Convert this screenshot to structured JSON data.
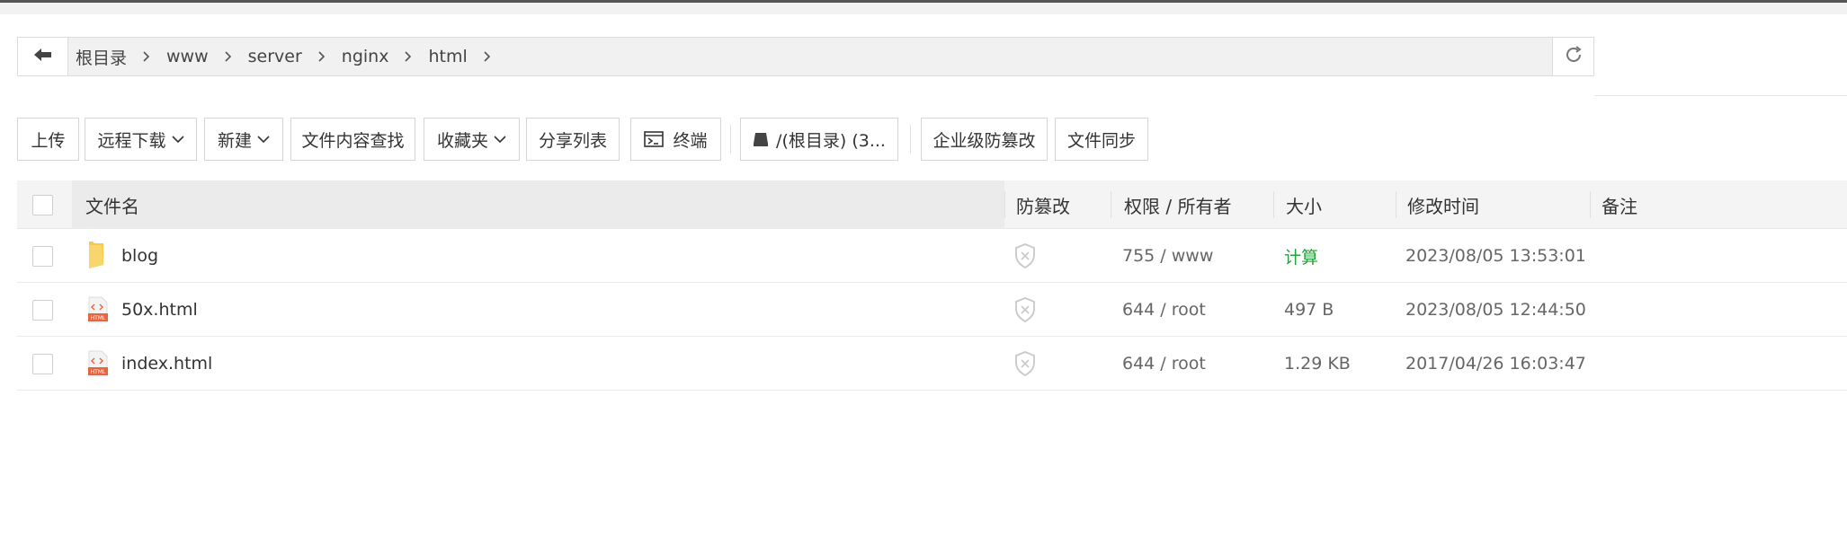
{
  "path": {
    "crumbs": [
      "根目录",
      "www",
      "server",
      "nginx",
      "html"
    ]
  },
  "toolbar": {
    "upload": "上传",
    "remote_download": "远程下载",
    "new": "新建",
    "content_search": "文件内容查找",
    "favorites": "收藏夹",
    "share_list": "分享列表",
    "terminal": "终端",
    "disk": "/(根目录) (3...",
    "enterprise_tamper": "企业级防篡改",
    "file_sync": "文件同步"
  },
  "table": {
    "headers": {
      "name": "文件名",
      "tamper": "防篡改",
      "perm": "权限 / 所有者",
      "size": "大小",
      "mtime": "修改时间",
      "note": "备注"
    },
    "rows": [
      {
        "name": "blog",
        "type": "folder",
        "perm": "755 / www",
        "size": "计算",
        "mtime": "2023/08/05 13:53:01",
        "note": ""
      },
      {
        "name": "50x.html",
        "type": "html",
        "perm": "644 / root",
        "size": "497 B",
        "mtime": "2023/08/05 12:44:50",
        "note": ""
      },
      {
        "name": "index.html",
        "type": "html",
        "perm": "644 / root",
        "size": "1.29 KB",
        "mtime": "2017/04/26 16:03:47",
        "note": ""
      }
    ]
  },
  "colors": {
    "accent_green": "#20a53a",
    "html_icon": "#e8643c",
    "folder": "#f7c948"
  },
  "icons": {
    "back": "arrow-left-icon",
    "refresh": "refresh-icon",
    "terminal": "terminal-icon",
    "disk": "disk-icon",
    "folder": "folder-icon",
    "html": "html-file-icon",
    "tamper": "shield-x-icon"
  }
}
